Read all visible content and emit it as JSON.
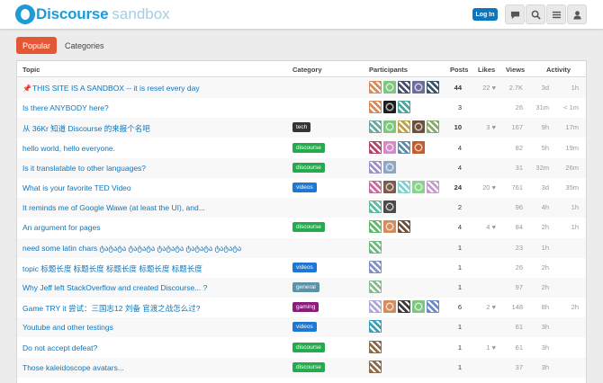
{
  "header": {
    "brand": "Discourse",
    "brand_sub": "sandbox",
    "login_label": "Log In",
    "icons": [
      "chat-icon",
      "search-icon",
      "menu-icon",
      "user-icon"
    ]
  },
  "nav": {
    "popular": "Popular",
    "categories": "Categories"
  },
  "columns": {
    "topic": "Topic",
    "category": "Category",
    "participants": "Participants",
    "posts": "Posts",
    "likes": "Likes",
    "views": "Views",
    "activity": "Activity"
  },
  "colors": {
    "accent": "#e45735",
    "link": "#0e76bd",
    "brand": "#1e9bd7",
    "tech": "#333333",
    "discourse": "#25aa4e",
    "videos": "#1e77d2",
    "general": "#5a93a8",
    "gaming": "#8a1c7c"
  },
  "topics": [
    {
      "title": "THIS SITE IS A SANDBOX -- it is reset every day",
      "pinned": true,
      "category": "",
      "category_color": "",
      "avatars": [
        "#d58b5b",
        "#7ec77e",
        "#46506a",
        "#6c6c9f",
        "#36556b"
      ],
      "posts": "44",
      "likes": "22",
      "views": "2.7K",
      "act1": "3d",
      "act2": "1h"
    },
    {
      "title": "Is there ANYBODY here?",
      "pinned": false,
      "category": "",
      "category_color": "",
      "avatars": [
        "#d58b5b",
        "#1e1e1e",
        "#4aa59a"
      ],
      "posts": "3",
      "likes": "",
      "views": "26",
      "act1": "31m",
      "act2": "< 1m"
    },
    {
      "title": "从 36Kr 知道 Discourse 的来报个名吧",
      "pinned": false,
      "category": "tech",
      "category_color": "#333333",
      "avatars": [
        "#6aa6a0",
        "#7ec77e",
        "#bda14a",
        "#6b4f3a",
        "#88a76b"
      ],
      "posts": "10",
      "likes": "3",
      "views": "167",
      "act1": "9h",
      "act2": "17m"
    },
    {
      "title": "hello world, hello everyone.",
      "pinned": false,
      "category": "discourse",
      "category_color": "#25aa4e",
      "avatars": [
        "#b5446a",
        "#d48ac9",
        "#5e8aa8",
        "#c25c2f"
      ],
      "posts": "4",
      "likes": "",
      "views": "82",
      "act1": "5h",
      "act2": "19m"
    },
    {
      "title": "Is it translatable to other languages?",
      "pinned": false,
      "category": "discourse",
      "category_color": "#25aa4e",
      "avatars": [
        "#9d8fc7",
        "#8ca6c4"
      ],
      "posts": "4",
      "likes": "",
      "views": "31",
      "act1": "32m",
      "act2": "26m"
    },
    {
      "title": "What is your favorite TED Video",
      "pinned": false,
      "category": "videos",
      "category_color": "#1e77d2",
      "avatars": [
        "#c76a9a",
        "#7a5a4a",
        "#7fd0d0",
        "#8ad38a",
        "#c89bd0"
      ],
      "posts": "24",
      "likes": "20",
      "views": "761",
      "act1": "3d",
      "act2": "35m"
    },
    {
      "title": "It reminds me of Google Wawe (at least the UI), and...",
      "pinned": false,
      "category": "",
      "category_color": "",
      "avatars": [
        "#5fb9a0",
        "#4a4a4a"
      ],
      "posts": "2",
      "likes": "",
      "views": "96",
      "act1": "4h",
      "act2": "1h"
    },
    {
      "title": "An argument for pages",
      "pinned": false,
      "category": "discourse",
      "category_color": "#25aa4e",
      "avatars": [
        "#5fb96a",
        "#d58b5b",
        "#6b4f3a"
      ],
      "posts": "4",
      "likes": "4",
      "views": "84",
      "act1": "2h",
      "act2": "1h"
    },
    {
      "title": "need some latin chars ტატატა ტატატა ტატატა ტატატა ტატატა",
      "pinned": false,
      "category": "",
      "category_color": "",
      "avatars": [
        "#6dba7a"
      ],
      "posts": "1",
      "likes": "",
      "views": "23",
      "act1": "1h",
      "act2": ""
    },
    {
      "title": "topic 标题长度 标题长度 标题长度 标题长度 标题长度",
      "pinned": false,
      "category": "videos",
      "category_color": "#1e77d2",
      "avatars": [
        "#7f8fc7"
      ],
      "posts": "1",
      "likes": "",
      "views": "26",
      "act1": "2h",
      "act2": ""
    },
    {
      "title": "Why Jeff left StackOverflow and created Discourse... ?",
      "pinned": false,
      "category": "general",
      "category_color": "#5a93a8",
      "avatars": [
        "#86b98c"
      ],
      "posts": "1",
      "likes": "",
      "views": "97",
      "act1": "2h",
      "act2": ""
    },
    {
      "title": "Game TRY it 尝试：三国志12 刘备 官渡之战怎么过?",
      "pinned": false,
      "category": "gaming",
      "category_color": "#8a1c7c",
      "avatars": [
        "#b0a8d8",
        "#d58b5b",
        "#3a3a3a",
        "#7ec77e",
        "#6a8acb"
      ],
      "posts": "6",
      "likes": "2",
      "views": "148",
      "act1": "8h",
      "act2": "2h"
    },
    {
      "title": "Youtube and other testings",
      "pinned": false,
      "category": "videos",
      "category_color": "#1e77d2",
      "avatars": [
        "#3aa0b8"
      ],
      "posts": "1",
      "likes": "",
      "views": "61",
      "act1": "3h",
      "act2": ""
    },
    {
      "title": "Do not accept defeat?",
      "pinned": false,
      "category": "discourse",
      "category_color": "#25aa4e",
      "avatars": [
        "#8a6a4a"
      ],
      "posts": "1",
      "likes": "1",
      "views": "61",
      "act1": "3h",
      "act2": ""
    },
    {
      "title": "Those kaleidoscope avatars...",
      "pinned": false,
      "category": "discourse",
      "category_color": "#25aa4e",
      "avatars": [
        "#8a6a4a"
      ],
      "posts": "1",
      "likes": "",
      "views": "37",
      "act1": "3h",
      "act2": ""
    }
  ]
}
